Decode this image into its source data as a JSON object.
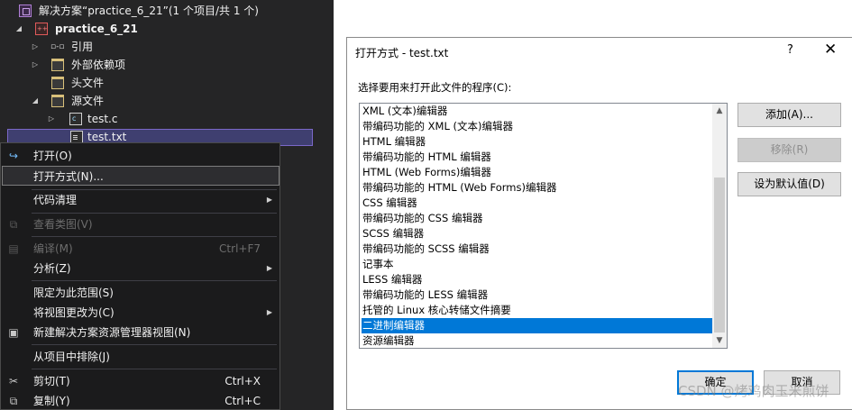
{
  "solution_explorer": {
    "solution_label": "解决方案“practice_6_21”(1 个项目/共 1 个)",
    "project_label": "practice_6_21",
    "items": [
      {
        "label": "引用"
      },
      {
        "label": "外部依赖项"
      },
      {
        "label": "头文件"
      },
      {
        "label": "源文件"
      },
      {
        "label": "test.c"
      },
      {
        "label": "test.txt"
      }
    ]
  },
  "context_menu": {
    "items": [
      {
        "label": "打开(O)",
        "shortcut": "",
        "icon": "open-icon"
      },
      {
        "label": "打开方式(N)...",
        "shortcut": ""
      },
      {
        "label": "代码清理",
        "shortcut": ""
      },
      {
        "label": "查看类图(V)",
        "shortcut": "",
        "icon": "class-diagram-icon"
      },
      {
        "label": "编译(M)",
        "shortcut": "Ctrl+F7",
        "icon": "compile-icon"
      },
      {
        "label": "分析(Z)",
        "shortcut": ""
      },
      {
        "label": "限定为此范围(S)",
        "shortcut": ""
      },
      {
        "label": "将视图更改为(C)",
        "shortcut": ""
      },
      {
        "label": "新建解决方案资源管理器视图(N)",
        "shortcut": "",
        "icon": "new-view-icon"
      },
      {
        "label": "从项目中排除(J)",
        "shortcut": ""
      },
      {
        "label": "剪切(T)",
        "shortcut": "Ctrl+X",
        "icon": "cut-icon"
      },
      {
        "label": "复制(Y)",
        "shortcut": "Ctrl+C",
        "icon": "copy-icon"
      }
    ]
  },
  "dialog": {
    "title": "打开方式 - test.txt",
    "help": "?",
    "close": "✕",
    "prompt": "选择要用来打开此文件的程序(C):",
    "programs": [
      "XML (文本)编辑器",
      "带编码功能的 XML (文本)编辑器",
      "HTML 编辑器",
      "带编码功能的 HTML 编辑器",
      "HTML (Web Forms)编辑器",
      "带编码功能的 HTML (Web Forms)编辑器",
      "CSS 编辑器",
      "带编码功能的 CSS 编辑器",
      "SCSS 编辑器",
      "带编码功能的 SCSS 编辑器",
      "记事本",
      "LESS 编辑器",
      "带编码功能的 LESS 编辑器",
      "托管的 Linux 核心转储文件摘要",
      "二进制编辑器",
      "资源编辑器"
    ],
    "selected_program": "二进制编辑器",
    "buttons": {
      "add": "添加(A)...",
      "remove": "移除(R)",
      "set_default": "设为默认值(D)",
      "ok": "确定",
      "cancel": "取消"
    }
  },
  "watermark": "CSDN @烤鸡肉玉米煎饼",
  "colors": {
    "panel_bg": "#252526",
    "menu_bg": "#1b1b1c",
    "selection_blue": "#0078d7",
    "tree_selection": "#3f3f70"
  }
}
